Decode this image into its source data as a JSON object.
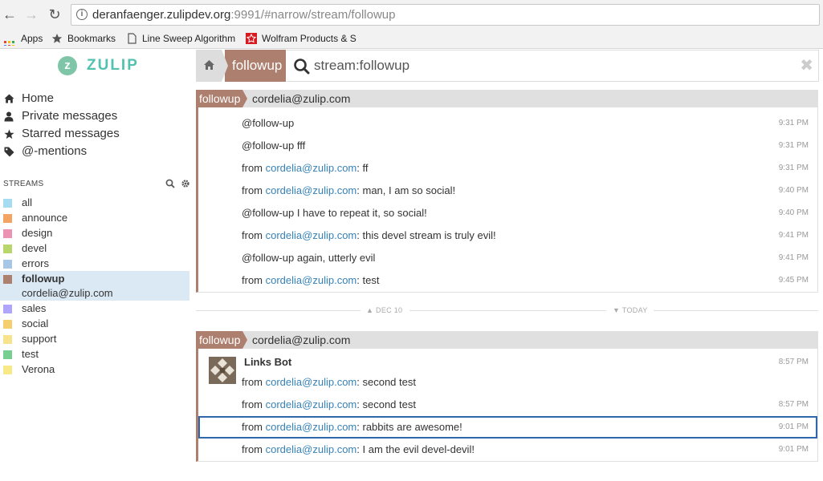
{
  "browser": {
    "url_host": "deranfaenger.zulipdev.org",
    "url_rest": ":9991/#narrow/stream/followup",
    "bookmarks": [
      {
        "label": "Apps"
      },
      {
        "label": "Bookmarks"
      },
      {
        "label": "Line Sweep Algorithm"
      },
      {
        "label": "Wolfram Products & S"
      }
    ]
  },
  "app": {
    "logo_text": "ZULIP",
    "logo_letter": "z"
  },
  "narrow": {
    "stream_tab": "followup",
    "search_query": "stream:followup"
  },
  "nav": {
    "items": [
      {
        "label": "Home",
        "icon": "home-icon"
      },
      {
        "label": "Private messages",
        "icon": "user-icon"
      },
      {
        "label": "Starred messages",
        "icon": "star-icon"
      },
      {
        "label": "@-mentions",
        "icon": "tag-icon"
      }
    ]
  },
  "streams": {
    "header": "STREAMS",
    "items": [
      {
        "name": "all",
        "color": "#a6dcf1"
      },
      {
        "name": "announce",
        "color": "#f3a463"
      },
      {
        "name": "design",
        "color": "#ec92b2"
      },
      {
        "name": "devel",
        "color": "#b8d66c"
      },
      {
        "name": "errors",
        "color": "#a6c7e5"
      },
      {
        "name": "followup",
        "color": "#ad7f6f"
      },
      {
        "name": "sales",
        "color": "#b0a5fd"
      },
      {
        "name": "social",
        "color": "#f5ce6e"
      },
      {
        "name": "support",
        "color": "#f7e38c"
      },
      {
        "name": "test",
        "color": "#76ce90"
      },
      {
        "name": "Verona",
        "color": "#f8e988"
      }
    ],
    "active_topic": "cordelia@zulip.com"
  },
  "groups": [
    {
      "stream": "followup",
      "topic": "cordelia@zulip.com",
      "messages": [
        {
          "pre": "@follow-up",
          "link": "",
          "post": "",
          "time": "9:31 PM"
        },
        {
          "pre": "@follow-up fff",
          "link": "",
          "post": "",
          "time": "9:31 PM"
        },
        {
          "pre": "from ",
          "link": "cordelia@zulip.com",
          "post": ": ff",
          "time": "9:31 PM"
        },
        {
          "pre": "from ",
          "link": "cordelia@zulip.com",
          "post": ": man, I am so social!",
          "time": "9:40 PM"
        },
        {
          "pre": "@follow-up I have to repeat it, so social!",
          "link": "",
          "post": "",
          "time": "9:40 PM"
        },
        {
          "pre": "from ",
          "link": "cordelia@zulip.com",
          "post": ": this devel stream is truly evil!",
          "time": "9:41 PM"
        },
        {
          "pre": "@follow-up again, utterly evil",
          "link": "",
          "post": "",
          "time": "9:41 PM"
        },
        {
          "pre": "from ",
          "link": "cordelia@zulip.com",
          "post": ": test",
          "time": "9:45 PM"
        }
      ]
    },
    {
      "stream": "followup",
      "topic": "cordelia@zulip.com",
      "sender": "Links Bot",
      "sender_time": "8:57 PM",
      "messages": [
        {
          "pre": "from ",
          "link": "cordelia@zulip.com",
          "post": ": second test",
          "time": ""
        },
        {
          "pre": "from ",
          "link": "cordelia@zulip.com",
          "post": ": second test",
          "time": "8:57 PM"
        },
        {
          "pre": "from ",
          "link": "cordelia@zulip.com",
          "post": ": rabbits are awesome!",
          "time": "9:01 PM"
        },
        {
          "pre": "from ",
          "link": "cordelia@zulip.com",
          "post": ": I am the evil devel-devil!",
          "time": "9:01 PM"
        }
      ]
    }
  ],
  "date_separator": {
    "left": "DEC 10",
    "right": "TODAY"
  },
  "colors": {
    "stream_followup": "#ad7f6f",
    "link": "#3782b9",
    "selected_border": "#2e68aa",
    "active_stream_bg": "#dae9f4"
  }
}
